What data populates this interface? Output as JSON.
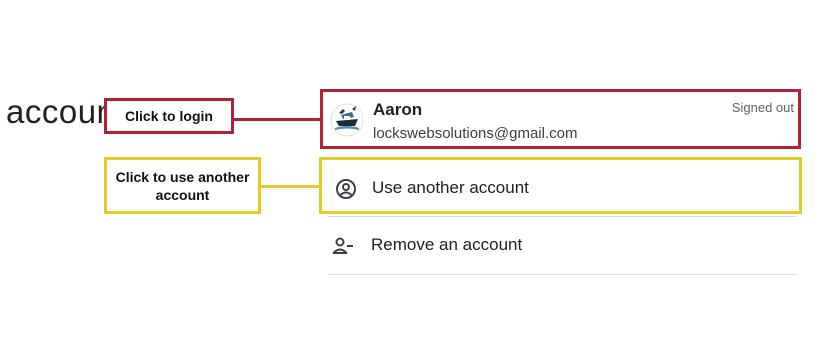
{
  "heading": {
    "partial_text": "accounts"
  },
  "callouts": {
    "login": "Click to login",
    "use_another": "Click to use another account"
  },
  "account": {
    "name": "Aaron",
    "email": "lockswebsolutions@gmail.com",
    "status": "Signed out",
    "avatar_icon": "ship-avatar-icon"
  },
  "actions": {
    "use_another_label": "Use another account",
    "use_another_icon": "account-circle-icon",
    "remove_label": "Remove an account",
    "remove_icon": "person-remove-icon"
  },
  "colors": {
    "login_highlight": "#b22234",
    "use_highlight": "#e5cc2a",
    "divider": "#dadce0"
  }
}
